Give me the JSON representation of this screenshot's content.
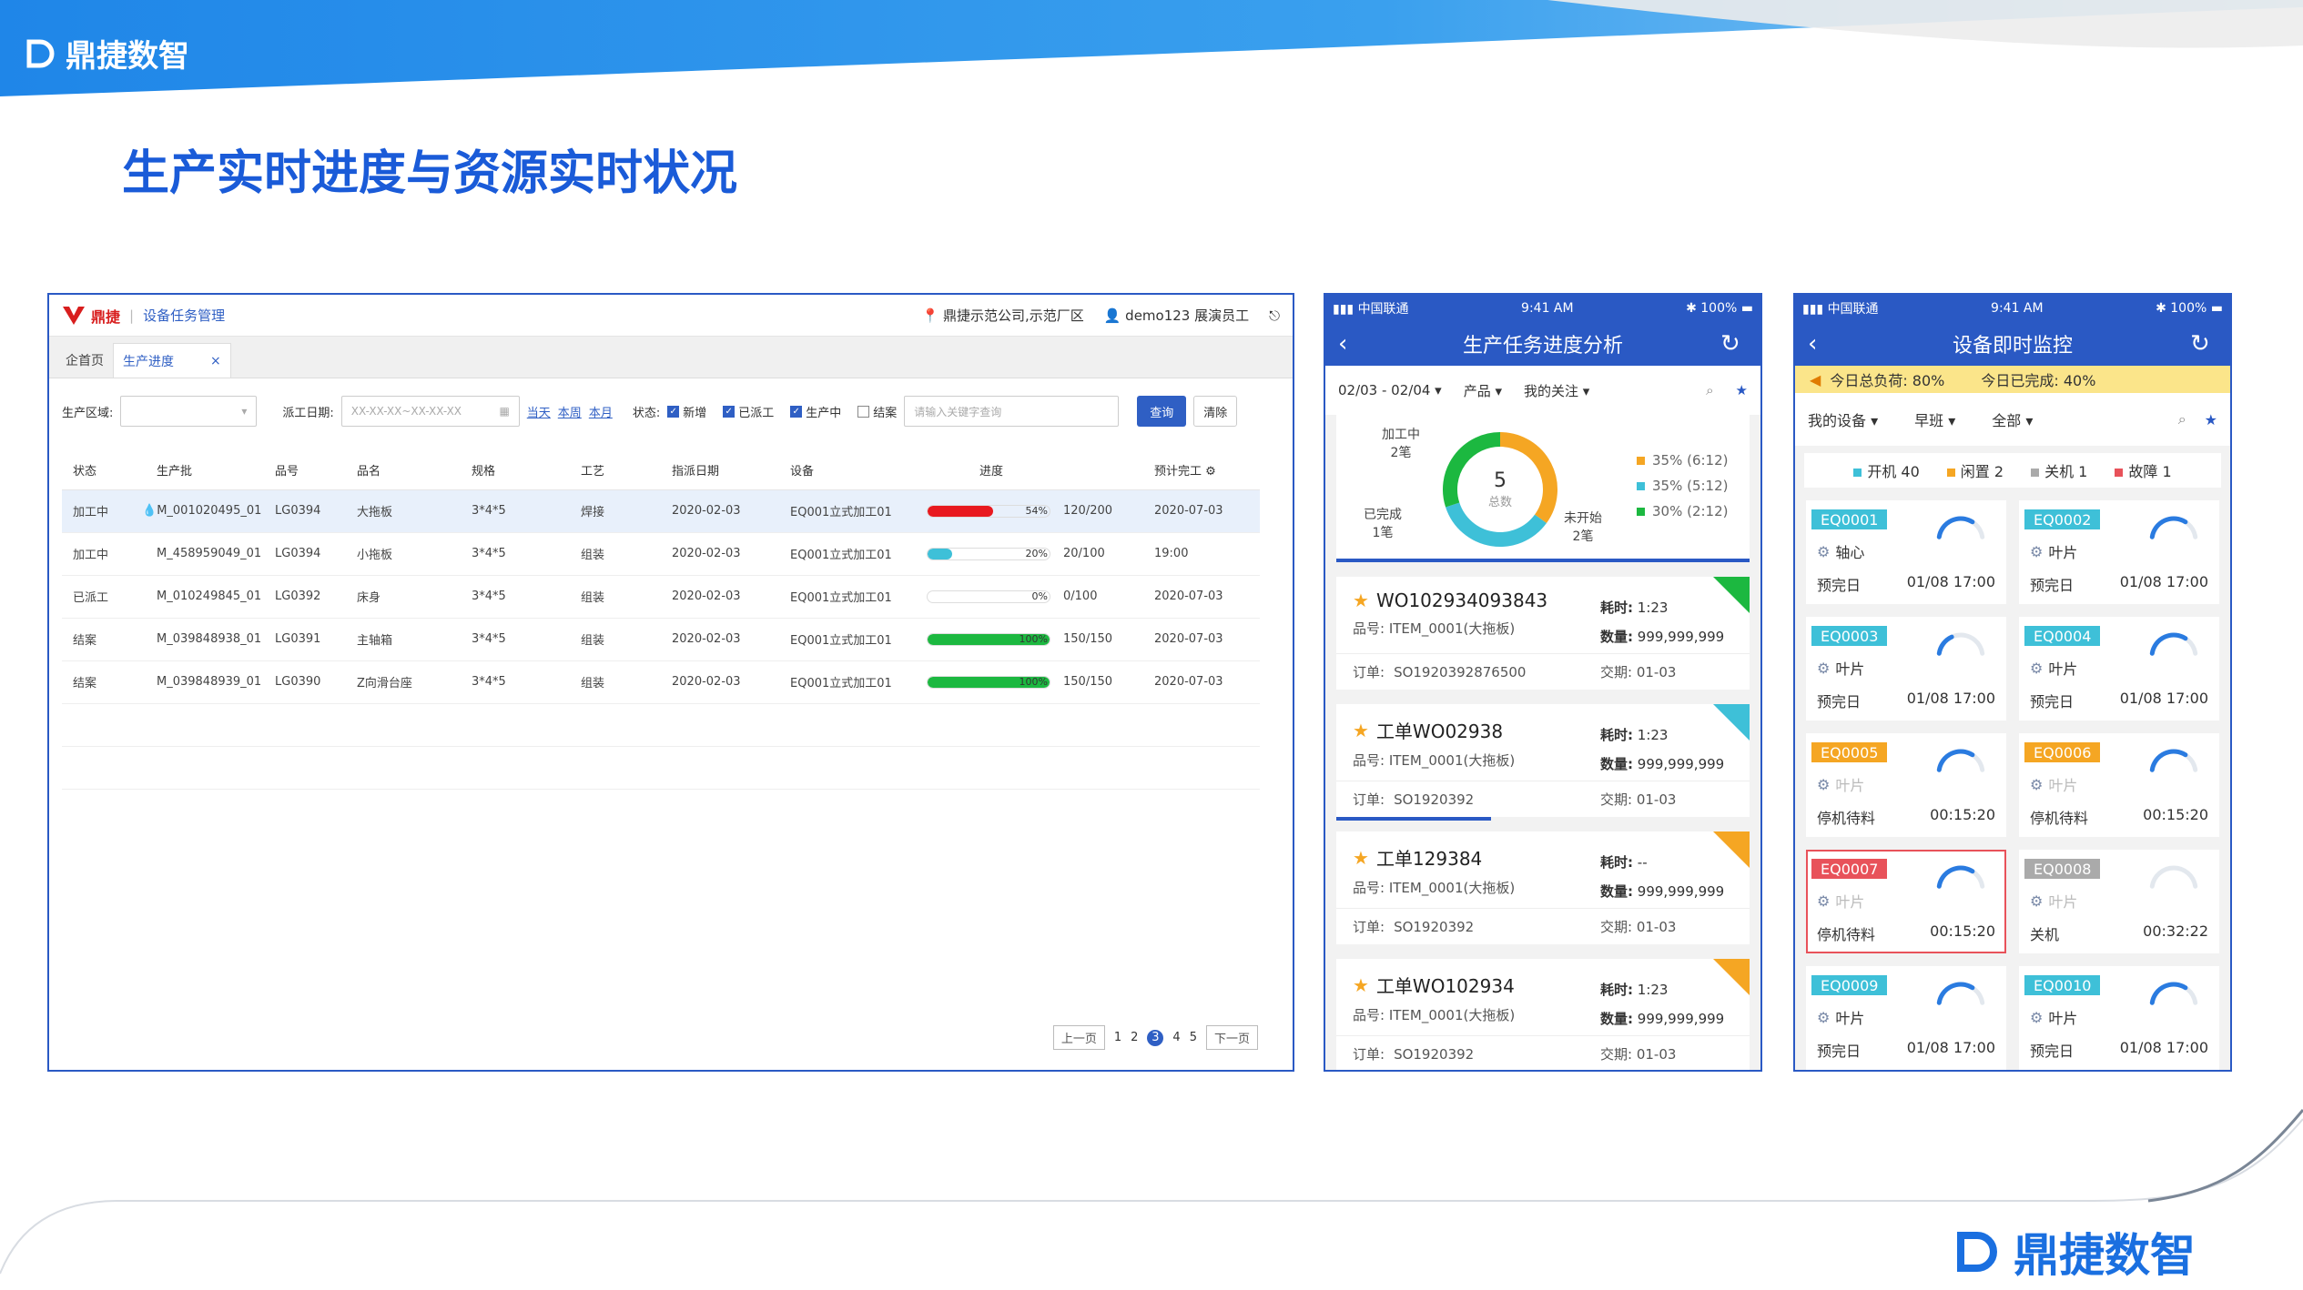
{
  "brand": {
    "name": "鼎捷数智"
  },
  "slide_title": "生产实时进度与资源实时状况",
  "colors": {
    "brand_blue": "#1a5bd8",
    "panel_blue": "#2a59c4",
    "red": "#e8191f",
    "green": "#1cb840",
    "cyan": "#3ec0d8",
    "yellow": "#f5a623"
  },
  "web": {
    "logo_text": "鼎捷",
    "module": "设备任务管理",
    "location": "鼎捷示范公司,示范厂区",
    "user": "demo123 展演员工",
    "tabs": [
      {
        "label": "企首页"
      },
      {
        "label": "生产进度",
        "close": "×"
      }
    ],
    "filter": {
      "area_label": "生产区域:",
      "date_label": "派工日期:",
      "date_placeholder": "XX-XX-XX~XX-XX-XX",
      "quick": [
        "当天",
        "本周",
        "本月"
      ],
      "status_label": "状态:",
      "statuses": [
        {
          "label": "新增",
          "checked": true
        },
        {
          "label": "已派工",
          "checked": true
        },
        {
          "label": "生产中",
          "checked": true
        },
        {
          "label": "结案",
          "checked": false
        }
      ],
      "keyword_placeholder": "请输入关键字查询",
      "query_label": "查询",
      "clear_label": "清除"
    },
    "columns": [
      "状态",
      "生产批",
      "品号",
      "品名",
      "规格",
      "工艺",
      "指派日期",
      "设备",
      "进度",
      "预计完工"
    ],
    "rows": [
      {
        "status": "加工中",
        "batch": "M_001020495_01",
        "part_no": "LG0394",
        "part_name": "大拖板",
        "spec": "3*4*5",
        "process": "焊接",
        "date": "2020-02-03",
        "device": "EQ001立式加工01",
        "pct": 54,
        "pct_label": "54%",
        "qty": "120/200",
        "due": "2020-07-03",
        "bar_color": "#e8191f",
        "flag": true,
        "selected": true
      },
      {
        "status": "加工中",
        "batch": "M_458959049_01",
        "part_no": "LG0394",
        "part_name": "小拖板",
        "spec": "3*4*5",
        "process": "组装",
        "date": "2020-02-03",
        "device": "EQ001立式加工01",
        "pct": 20,
        "pct_label": "20%",
        "qty": "20/100",
        "due": "19:00",
        "bar_color": "#3ec0d8",
        "flag": false,
        "selected": false
      },
      {
        "status": "已派工",
        "batch": "M_010249845_01",
        "part_no": "LG0392",
        "part_name": "床身",
        "spec": "3*4*5",
        "process": "组装",
        "date": "2020-02-03",
        "device": "EQ001立式加工01",
        "pct": 0,
        "pct_label": "0%",
        "qty": "0/100",
        "due": "2020-07-03",
        "bar_color": "#3ec0d8",
        "flag": false,
        "selected": false
      },
      {
        "status": "结案",
        "batch": "M_039848938_01",
        "part_no": "LG0391",
        "part_name": "主轴箱",
        "spec": "3*4*5",
        "process": "组装",
        "date": "2020-02-03",
        "device": "EQ001立式加工01",
        "pct": 100,
        "pct_label": "100%",
        "qty": "150/150",
        "due": "2020-07-03",
        "bar_color": "#1cb840",
        "flag": false,
        "selected": false
      },
      {
        "status": "结案",
        "batch": "M_039848939_01",
        "part_no": "LG0390",
        "part_name": "Z向滑台座",
        "spec": "3*4*5",
        "process": "组装",
        "date": "2020-02-03",
        "device": "EQ001立式加工01",
        "pct": 100,
        "pct_label": "100%",
        "qty": "150/150",
        "due": "2020-07-03",
        "bar_color": "#1cb840",
        "flag": false,
        "selected": false
      }
    ],
    "pager": {
      "prev": "上一页",
      "pages": [
        "1",
        "2",
        "3",
        "4",
        "5"
      ],
      "current": "3",
      "next": "下一页"
    }
  },
  "phone_status": {
    "carrier": "中国联通",
    "time": "9:41 AM",
    "battery": "100%"
  },
  "phone1": {
    "title": "生产任务进度分析",
    "filters": [
      "02/03 - 02/04 ▾",
      "产品 ▾",
      "我的关注 ▾"
    ],
    "donut": {
      "total": "5",
      "total_label": "总数",
      "labels": [
        {
          "text": "加工中\n2笔"
        },
        {
          "text": "已完成\n1笔"
        },
        {
          "text": "未开始\n2笔"
        }
      ],
      "legend": [
        {
          "text": "35% (6:12)",
          "color": "#f5a623"
        },
        {
          "text": "35% (5:12)",
          "color": "#3ec0d8"
        },
        {
          "text": "30% (2:12)",
          "color": "#1cb840"
        }
      ],
      "slices": [
        {
          "value": 35,
          "color": "#f5a623"
        },
        {
          "value": 35,
          "color": "#3ec0d8"
        },
        {
          "value": 30,
          "color": "#1cb840"
        }
      ]
    },
    "tasks": [
      {
        "name": "WO102934093843",
        "time_label": "耗时:",
        "time": "1:23",
        "part_label": "品号:",
        "part": "ITEM_0001(大拖板)",
        "qty_label": "数量:",
        "qty": "999,999,999",
        "order_label": "订单:",
        "order": "SO1920392876500",
        "due_label": "交期:",
        "due": "01-03",
        "tag_color": "#1cb840"
      },
      {
        "name": "工单WO02938",
        "time_label": "耗时:",
        "time": "1:23",
        "part_label": "品号:",
        "part": "ITEM_0001(大拖板)",
        "qty_label": "数量:",
        "qty": "999,999,999",
        "order_label": "订单:",
        "order": "SO1920392",
        "due_label": "交期:",
        "due": "01-03",
        "tag_color": "#3ec0d8"
      },
      {
        "name": "工单129384",
        "time_label": "耗时:",
        "time": "--",
        "part_label": "品号:",
        "part": "ITEM_0001(大拖板)",
        "qty_label": "数量:",
        "qty": "999,999,999",
        "order_label": "订单:",
        "order": "SO1920392",
        "due_label": "交期:",
        "due": "01-03",
        "tag_color": "#f5a623"
      },
      {
        "name": "工单WO102934",
        "time_label": "耗时:",
        "time": "1:23",
        "part_label": "品号:",
        "part": "ITEM_0001(大拖板)",
        "qty_label": "数量:",
        "qty": "999,999,999",
        "order_label": "订单:",
        "order": "SO1920392",
        "due_label": "交期:",
        "due": "01-03",
        "tag_color": "#f5a623"
      }
    ]
  },
  "phone2": {
    "title": "设备即时监控",
    "summary": [
      "今日总负荷: 80%",
      "今日已完成: 40%"
    ],
    "filters": [
      "我的设备 ▾",
      "早班 ▾",
      "全部 ▾"
    ],
    "legend": [
      {
        "text": "开机 40",
        "color": "#3ec0d8"
      },
      {
        "text": "闲置 2",
        "color": "#f5a623"
      },
      {
        "text": "关机 1",
        "color": "#aaaaaa"
      },
      {
        "text": "故障 1",
        "color": "#e8525a"
      }
    ],
    "devices": [
      {
        "code": "EQ0001",
        "part": "轴心",
        "state": "预完日",
        "time": "01/08 17:00",
        "code_color": "#3ec0d8",
        "gauge": 0.7,
        "gauge_color": "#2a7be0",
        "dim": false,
        "alert": false
      },
      {
        "code": "EQ0002",
        "part": "叶片",
        "state": "预完日",
        "time": "01/08 17:00",
        "code_color": "#3ec0d8",
        "gauge": 0.7,
        "gauge_color": "#2a7be0",
        "dim": false,
        "alert": false
      },
      {
        "code": "EQ0003",
        "part": "叶片",
        "state": "预完日",
        "time": "01/08 17:00",
        "code_color": "#3ec0d8",
        "gauge": 0.35,
        "gauge_color": "#2a7be0",
        "dim": false,
        "alert": false
      },
      {
        "code": "EQ0004",
        "part": "叶片",
        "state": "预完日",
        "time": "01/08 17:00",
        "code_color": "#3ec0d8",
        "gauge": 0.7,
        "gauge_color": "#2a7be0",
        "dim": false,
        "alert": false
      },
      {
        "code": "EQ0005",
        "part": "叶片",
        "state": "停机待料",
        "time": "00:15:20",
        "code_color": "#f5a623",
        "gauge": 0.7,
        "gauge_color": "#2a7be0",
        "dim": true,
        "alert": false
      },
      {
        "code": "EQ0006",
        "part": "叶片",
        "state": "停机待料",
        "time": "00:15:20",
        "code_color": "#f5a623",
        "gauge": 0.7,
        "gauge_color": "#2a7be0",
        "dim": true,
        "alert": false
      },
      {
        "code": "EQ0007",
        "part": "叶片",
        "state": "停机待料",
        "time": "00:15:20",
        "code_color": "#e8525a",
        "gauge": 0.7,
        "gauge_color": "#2a7be0",
        "dim": true,
        "alert": true
      },
      {
        "code": "EQ0008",
        "part": "叶片",
        "state": "关机",
        "time": "00:32:22",
        "code_color": "#aaaaaa",
        "gauge": 0.0,
        "gauge_color": "#dddddd",
        "dim": true,
        "alert": false
      },
      {
        "code": "EQ0009",
        "part": "叶片",
        "state": "预完日",
        "time": "01/08 17:00",
        "code_color": "#3ec0d8",
        "gauge": 0.7,
        "gauge_color": "#2a7be0",
        "dim": false,
        "alert": false
      },
      {
        "code": "EQ0010",
        "part": "叶片",
        "state": "预完日",
        "time": "01/08 17:00",
        "code_color": "#3ec0d8",
        "gauge": 0.7,
        "gauge_color": "#2a7be0",
        "dim": false,
        "alert": false
      }
    ]
  }
}
